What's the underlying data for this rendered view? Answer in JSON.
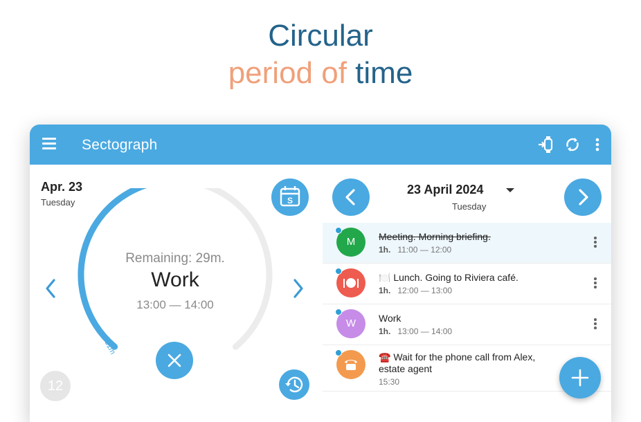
{
  "headline": {
    "line1": "Circular",
    "line2_part1": "period of",
    "line2_part2": "time"
  },
  "appbar": {
    "title": "Sectograph",
    "icons": [
      "menu-icon",
      "watch-sync-icon",
      "refresh-icon",
      "more-vert-icon"
    ]
  },
  "left": {
    "date": "Apr. 23",
    "day": "Tuesday",
    "calendar_day_letter": "S",
    "remaining": "Remaining: 29m.",
    "event_name": "Work",
    "event_time": "13:00 — 14:00",
    "arc_label": "31m",
    "elapsed_fraction": 0.52,
    "hour_badge": "12"
  },
  "right": {
    "date": "23 April 2024",
    "day": "Tuesday",
    "events": [
      {
        "avatar": "M",
        "color": "#22a84a",
        "title": "Meeting. Morning briefing.",
        "duration": "1h.",
        "time": "11:00 — 12:00",
        "done": true
      },
      {
        "avatar": "",
        "icon": "plate-icon",
        "color": "#ee5b4f",
        "title": "🍽️ Lunch. Going to Riviera café.",
        "duration": "1h.",
        "time": "12:00 — 13:00",
        "done": false
      },
      {
        "avatar": "W",
        "color": "#c68ce8",
        "title": "Work",
        "duration": "1h.",
        "time": "13:00 — 14:00",
        "done": false
      },
      {
        "avatar": "",
        "icon": "phone-icon",
        "color": "#f39a4e",
        "title_line1": "☎️ Wait for the phone call from Alex,",
        "title_line2": "estate agent",
        "time": "15:30",
        "done": false
      }
    ]
  },
  "colors": {
    "accent": "#4aa9e1",
    "headline_blue": "#24638a",
    "headline_orange": "#f0a07a"
  }
}
